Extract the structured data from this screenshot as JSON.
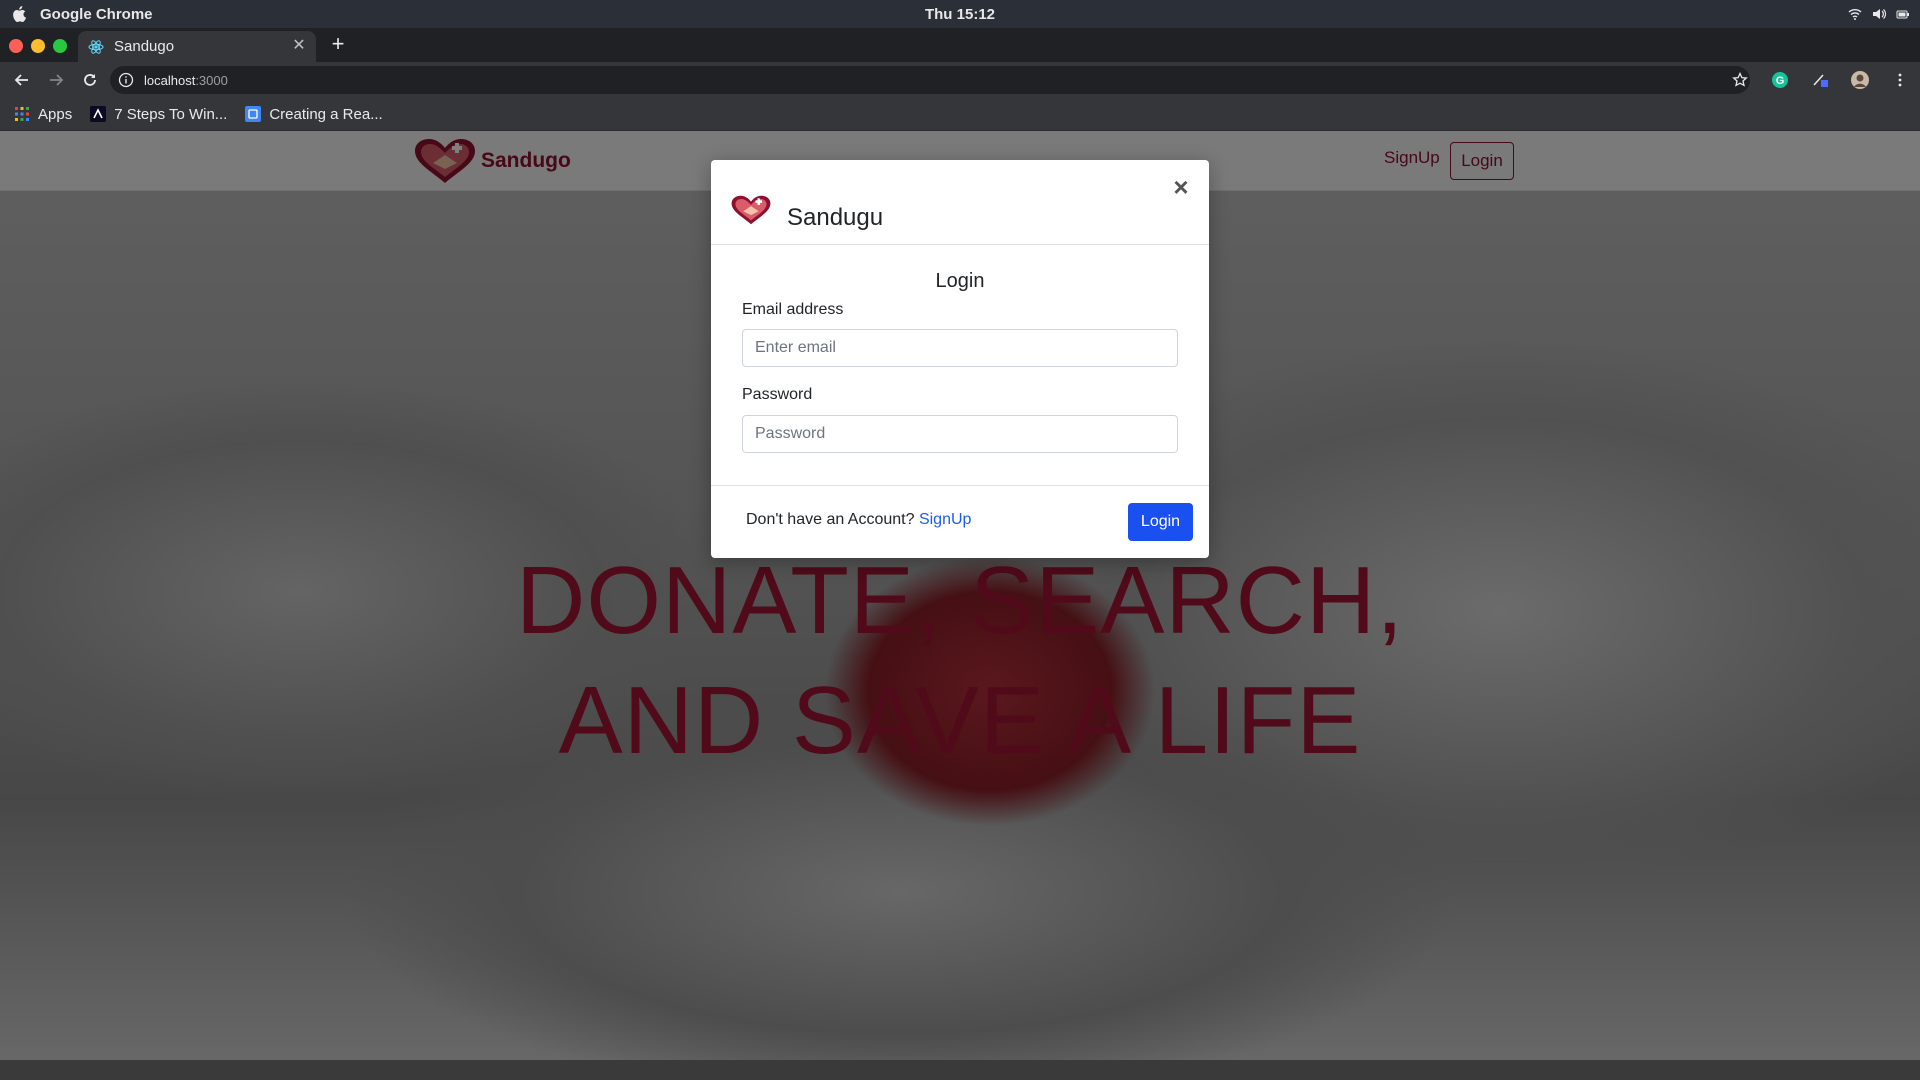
{
  "os": {
    "app_name": "Google Chrome",
    "clock": "Thu 15:12"
  },
  "browser": {
    "tab_title": "Sandugo",
    "url_host": "localhost",
    "url_port": ":3000",
    "bookmarks": [
      {
        "label": "Apps",
        "icon": "apps-grid-icon"
      },
      {
        "label": "7 Steps To Win...",
        "icon": "bookmark-a-icon"
      },
      {
        "label": "Creating a Rea...",
        "icon": "bookmark-doc-icon"
      }
    ]
  },
  "site": {
    "brand": "Sandugo",
    "nav_signup": "SignUp",
    "nav_login": "Login",
    "hero_line1": "DONATE, SEARCH,",
    "hero_line2": "AND SAVE A LIFE"
  },
  "modal": {
    "title": "Sandugu",
    "close_glyph": "×",
    "heading": "Login",
    "email_label": "Email address",
    "email_placeholder": "Enter email",
    "email_value": "",
    "password_label": "Password",
    "password_placeholder": "Password",
    "password_value": "",
    "footer_text": "Don't have an Account?",
    "footer_link": "SignUp",
    "submit_label": "Login"
  },
  "colors": {
    "brand": "#8e1030",
    "primary_button": "#1a4ff0",
    "link": "#1a5df5"
  }
}
